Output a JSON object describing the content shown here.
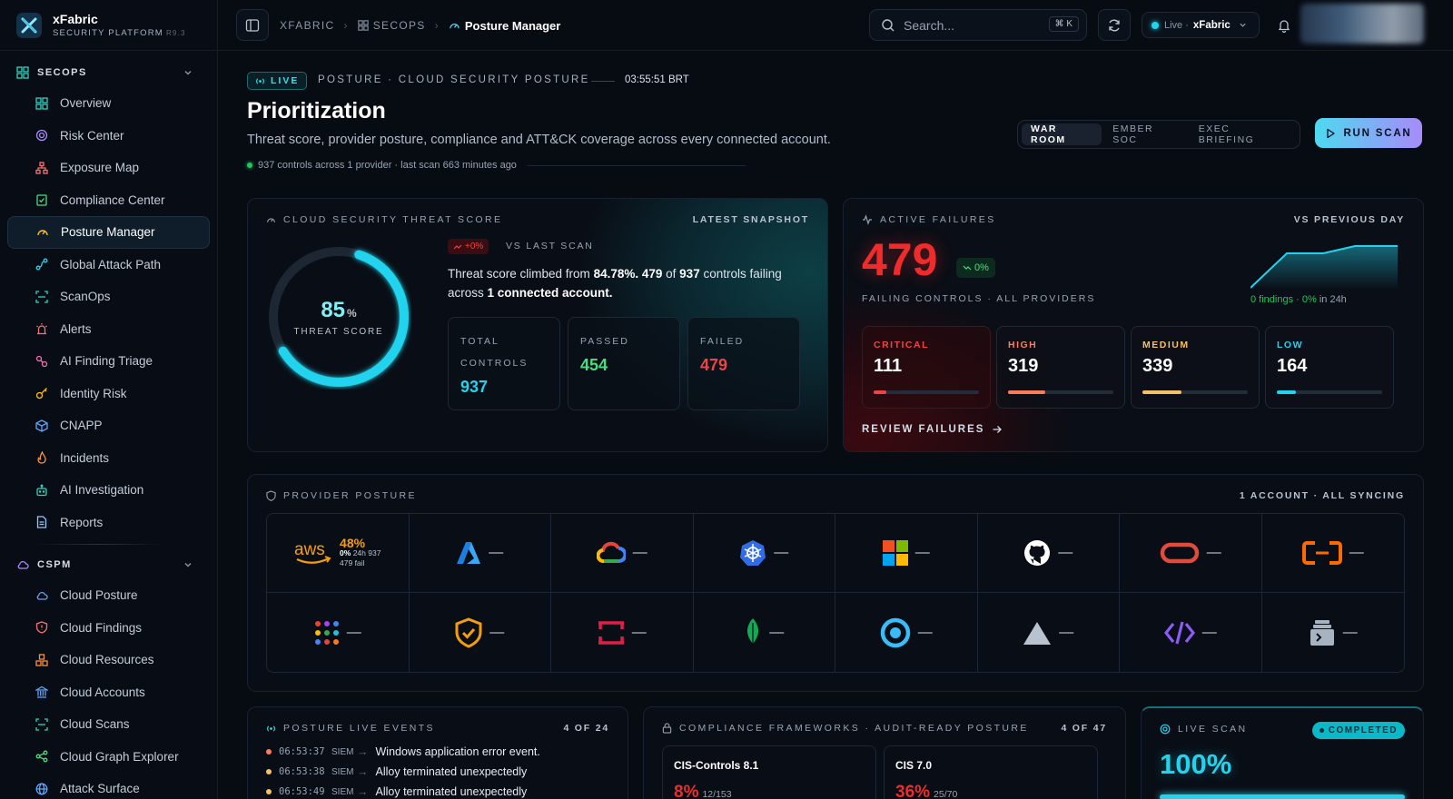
{
  "brand": {
    "name": "xFabric",
    "subtitle": "SECURITY PLATFORM",
    "version": "R9.3"
  },
  "sidebar": {
    "secops": {
      "title": "SECOPS",
      "items": [
        {
          "label": "Overview",
          "icon": "grid-icon"
        },
        {
          "label": "Risk Center",
          "icon": "target-icon"
        },
        {
          "label": "Exposure Map",
          "icon": "network-icon"
        },
        {
          "label": "Compliance Center",
          "icon": "clipboard-check-icon"
        },
        {
          "label": "Posture Manager",
          "icon": "gauge-icon"
        },
        {
          "label": "Global Attack Path",
          "icon": "route-icon"
        },
        {
          "label": "ScanOps",
          "icon": "scan-icon"
        },
        {
          "label": "Alerts",
          "icon": "siren-icon"
        },
        {
          "label": "AI Finding Triage",
          "icon": "sparkle-icon"
        },
        {
          "label": "Identity Risk",
          "icon": "key-icon"
        },
        {
          "label": "CNAPP",
          "icon": "box-icon"
        },
        {
          "label": "Incidents",
          "icon": "flame-icon"
        },
        {
          "label": "AI Investigation",
          "icon": "bot-icon"
        },
        {
          "label": "Reports",
          "icon": "file-text-icon"
        }
      ]
    },
    "cspm": {
      "title": "CSPM",
      "items": [
        {
          "label": "Cloud Posture",
          "icon": "cloud-icon"
        },
        {
          "label": "Cloud Findings",
          "icon": "shield-alert-icon"
        },
        {
          "label": "Cloud Resources",
          "icon": "boxes-icon"
        },
        {
          "label": "Cloud Accounts",
          "icon": "bank-icon"
        },
        {
          "label": "Cloud Scans",
          "icon": "scan-icon"
        },
        {
          "label": "Cloud Graph Explorer",
          "icon": "share-icon"
        },
        {
          "label": "Attack Surface",
          "icon": "globe-icon"
        }
      ]
    }
  },
  "topbar": {
    "crumbs": [
      "XFABRIC",
      "SECOPS",
      "Posture Manager"
    ],
    "search_placeholder": "Search...",
    "search_kbd": "⌘ K",
    "live_label": "Live ·",
    "tenant": "xFabric"
  },
  "header": {
    "live_tag": "LIVE",
    "eyebrow": "POSTURE · CLOUD SECURITY POSTURE",
    "time": "03:55:51 BRT",
    "title": "Prioritization",
    "subtitle": "Threat score, provider posture, compliance and ATT&CK coverage across every connected account.",
    "meta": "937 controls across 1 provider · last scan 663 minutes ago",
    "views": [
      "WAR ROOM",
      "EMBER SOC",
      "EXEC BRIEFING"
    ],
    "active_view": "WAR ROOM",
    "run_scan": "RUN SCAN"
  },
  "threat": {
    "label": "CLOUD SECURITY THREAT SCORE",
    "right_label": "LATEST SNAPSHOT",
    "score": "85",
    "score_unit": "%",
    "score_value": 0.85,
    "score_label": "THREAT SCORE",
    "delta": "+0%",
    "vs": "VS LAST SCAN",
    "desc_pre": "Threat score climbed from ",
    "desc_from": "84.78%.",
    "desc_failing": "479",
    "desc_of": " of ",
    "desc_total": "937",
    "desc_mid": " controls failing across ",
    "desc_accounts": "1 connected account.",
    "stats": [
      {
        "label": "TOTAL CONTROLS",
        "value": "937",
        "color": "#22d3ee"
      },
      {
        "label": "PASSED",
        "value": "454",
        "color": "#4ade80"
      },
      {
        "label": "FAILED",
        "value": "479",
        "color": "#ef4444"
      }
    ]
  },
  "failures": {
    "label": "ACTIVE FAILURES",
    "right_label": "VS PREVIOUS DAY",
    "count": "479",
    "delta": "0%",
    "sub": "FAILING CONTROLS · ALL PROVIDERS",
    "spark_note": "0 findings · 0%",
    "spark_note_suffix": "in 24h",
    "severities": [
      {
        "label": "CRITICAL",
        "value": "111",
        "color": "#ef4444",
        "share": 0.12
      },
      {
        "label": "HIGH",
        "value": "319",
        "color": "#fb7c5a",
        "share": 0.35
      },
      {
        "label": "MEDIUM",
        "value": "339",
        "color": "#f5c066",
        "share": 0.37
      },
      {
        "label": "LOW",
        "value": "164",
        "color": "#22d3ee",
        "share": 0.18
      }
    ],
    "review": "REVIEW FAILURES"
  },
  "providers": {
    "label": "PROVIDER POSTURE",
    "right_label": "1 ACCOUNT · ALL SYNCING",
    "aws": {
      "name": "aws",
      "pct": "48%",
      "d": "0%",
      "win": "24h",
      "total": "937",
      "fail": "479 fail"
    },
    "dash": "—",
    "icons": [
      "aws-icon",
      "azure-icon",
      "gcp-icon",
      "kubernetes-icon",
      "microsoft-icon",
      "github-icon",
      "oracle-icon",
      "alibaba-icon",
      "google-workspace-icon",
      "shield-icon",
      "ibm-cloud-icon",
      "mongodb-icon",
      "digitalocean-icon",
      "vercel-icon",
      "code-icon",
      "terminal-icon"
    ]
  },
  "events": {
    "label": "POSTURE LIVE EVENTS",
    "count": "4 OF 24",
    "rows": [
      {
        "time": "06:53:37",
        "src": "SIEM",
        "msg": "Windows application error event.",
        "color": "#fb7c5a"
      },
      {
        "time": "06:53:38",
        "src": "SIEM",
        "msg": "Alloy terminated unexpectedly",
        "color": "#f5c066"
      },
      {
        "time": "06:53:49",
        "src": "SIEM",
        "msg": "Alloy terminated unexpectedly",
        "color": "#f5c066"
      }
    ]
  },
  "frameworks": {
    "label": "COMPLIANCE FRAMEWORKS · AUDIT-READY POSTURE",
    "count": "4 OF 47",
    "items": [
      {
        "name": "CIS-Controls 8.1",
        "pct": "8%",
        "ratio": "12/153"
      },
      {
        "name": "CIS 7.0",
        "pct": "36%",
        "ratio": "25/70"
      }
    ]
  },
  "livescan": {
    "label": "LIVE SCAN",
    "status": "COMPLETED",
    "pct": "100%",
    "progress": 1.0
  }
}
